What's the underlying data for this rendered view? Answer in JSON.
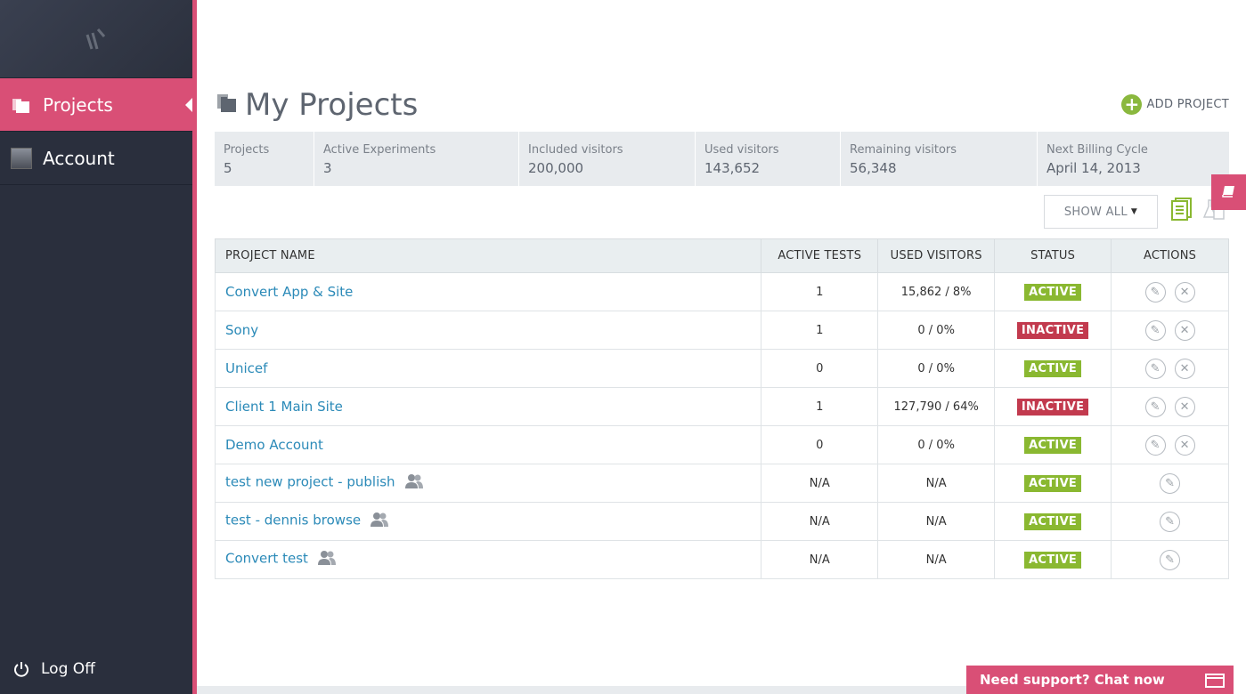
{
  "sidebar": {
    "items": [
      {
        "label": "Projects",
        "active": true,
        "icon": "folders-icon"
      },
      {
        "label": "Account",
        "active": false,
        "icon": "avatar"
      }
    ],
    "logoff_label": "Log Off"
  },
  "header": {
    "title": "My Projects",
    "add_project_label": "ADD PROJECT"
  },
  "stats": [
    {
      "label": "Projects",
      "value": "5"
    },
    {
      "label": "Active Experiments",
      "value": "3"
    },
    {
      "label": "Included visitors",
      "value": "200,000"
    },
    {
      "label": "Used visitors",
      "value": "143,652"
    },
    {
      "label": "Remaining visitors",
      "value": "56,348"
    },
    {
      "label": "Next Billing Cycle",
      "value": "April 14, 2013"
    }
  ],
  "filter": {
    "show_all_label": "SHOW ALL"
  },
  "table": {
    "headers": [
      "PROJECT NAME",
      "ACTIVE TESTS",
      "USED VISITORS",
      "STATUS",
      "ACTIONS"
    ],
    "rows": [
      {
        "name": "Convert App & Site",
        "active_tests": "1",
        "used_visitors": "15,862 / 8%",
        "status": "ACTIVE"
      },
      {
        "name": "Sony",
        "active_tests": "1",
        "used_visitors": "0 / 0%",
        "status": "INACTIVE"
      },
      {
        "name": "Unicef",
        "active_tests": "0",
        "used_visitors": "0 / 0%",
        "status": "ACTIVE"
      },
      {
        "name": "Client 1 Main Site",
        "active_tests": "1",
        "used_visitors": "127,790 / 64%",
        "status": "INACTIVE"
      },
      {
        "name": "Demo Account",
        "active_tests": "0",
        "used_visitors": "0 / 0%",
        "status": "ACTIVE"
      },
      {
        "name": "test new project - publish",
        "active_tests": "N/A",
        "used_visitors": "N/A",
        "status": "ACTIVE"
      },
      {
        "name": "test - dennis browse",
        "active_tests": "N/A",
        "used_visitors": "N/A",
        "status": "ACTIVE"
      },
      {
        "name": "Convert test",
        "active_tests": "N/A",
        "used_visitors": "N/A",
        "status": "ACTIVE"
      }
    ]
  },
  "support": {
    "chat_label": "Need support? Chat now"
  },
  "colors": {
    "accent": "#d94f76",
    "sidebar": "#2a2f3d",
    "active_badge": "#8ab831",
    "inactive_badge": "#c23a4e",
    "link": "#2b8ab8"
  }
}
